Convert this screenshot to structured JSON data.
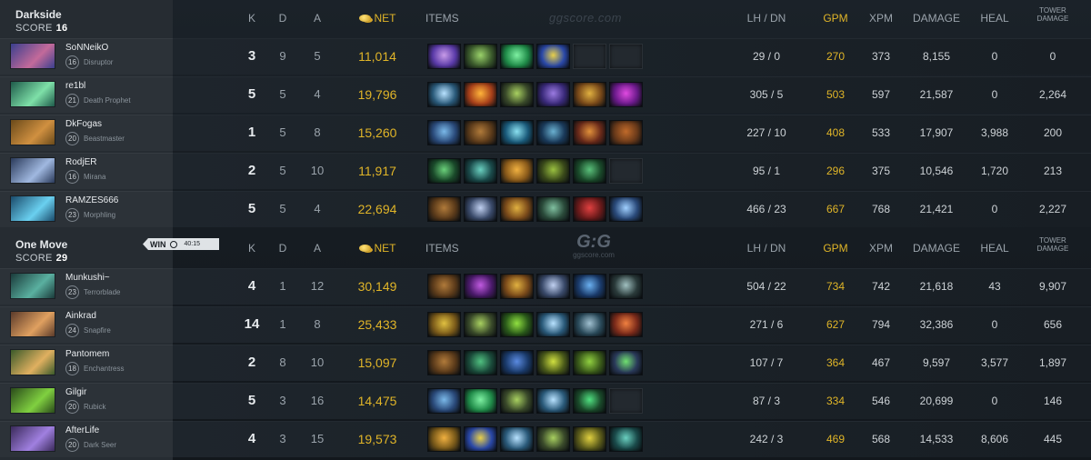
{
  "header_columns": {
    "k": "K",
    "d": "D",
    "a": "A",
    "net": "NET",
    "items": "ITEMS",
    "lhdn": "LH / DN",
    "gpm": "GPM",
    "xpm": "XPM",
    "damage": "DAMAGE",
    "heal": "HEAL",
    "tower": "TOWER DAMAGE"
  },
  "watermark_text": "ggscore.com",
  "logo": {
    "big": "G:G",
    "small": "ggscore.com"
  },
  "win_badge": {
    "label": "WIN",
    "time": "40:15"
  },
  "score_label": "SCORE",
  "teams": [
    {
      "name": "Darkside",
      "score": "16",
      "players": [
        {
          "player": "SoNNeikO",
          "level": "16",
          "hero": "Disruptor",
          "portrait": [
            "#3a3f8e",
            "#c36a9a"
          ],
          "k": "3",
          "d": "9",
          "a": "5",
          "net": "11,014",
          "items": [
            [
              "#5a3aa8",
              "#c89be8"
            ],
            [
              "#3b5a2c",
              "#9ad26a"
            ],
            [
              "#1f8a48",
              "#7ef0a2"
            ],
            [
              "#2a48a8",
              "#e8d04a"
            ],
            null,
            null
          ],
          "lhdn": "29 / 0",
          "gpm": "270",
          "xpm": "373",
          "damage": "8,155",
          "heal": "0",
          "tower": "0"
        },
        {
          "player": "re1bl",
          "level": "21",
          "hero": "Death Prophet",
          "portrait": [
            "#1e5a4a",
            "#7ee0a8"
          ],
          "k": "5",
          "d": "5",
          "a": "4",
          "net": "19,796",
          "items": [
            [
              "#2a5a7a",
              "#b8e2ff"
            ],
            [
              "#a8401a",
              "#ffb43a"
            ],
            [
              "#3a4a2a",
              "#a8d060"
            ],
            [
              "#3a2a7a",
              "#9a7ae0"
            ],
            [
              "#7a4a1a",
              "#e0b040"
            ],
            [
              "#6a1a8a",
              "#e04ae0"
            ]
          ],
          "lhdn": "305 / 5",
          "gpm": "503",
          "xpm": "597",
          "damage": "21,587",
          "heal": "0",
          "tower": "2,264"
        },
        {
          "player": "DkFogas",
          "level": "20",
          "hero": "Beastmaster",
          "portrait": [
            "#6a4a1a",
            "#d09040"
          ],
          "k": "1",
          "d": "5",
          "a": "8",
          "net": "15,260",
          "items": [
            [
              "#2a4a7a",
              "#7ab8e8"
            ],
            [
              "#5a3a1a",
              "#b07a3a"
            ],
            [
              "#1a5a7a",
              "#8ae0f0"
            ],
            [
              "#1a3a5a",
              "#6ab0d0"
            ],
            [
              "#6a2a1a",
              "#e0903a"
            ],
            [
              "#6a3a1a",
              "#c06a2a"
            ]
          ],
          "lhdn": "227 / 10",
          "gpm": "408",
          "xpm": "533",
          "damage": "17,907",
          "heal": "3,988",
          "tower": "200"
        },
        {
          "player": "RodjER",
          "level": "16",
          "hero": "Mirana",
          "portrait": [
            "#2a3a5a",
            "#a0b8e0"
          ],
          "k": "2",
          "d": "5",
          "a": "10",
          "net": "11,917",
          "items": [
            [
              "#1a4a2a",
              "#6ad07a"
            ],
            [
              "#1a4a4a",
              "#6ad0c0"
            ],
            [
              "#8a5a1a",
              "#f0b040"
            ],
            [
              "#3a4a1a",
              "#9ac040"
            ],
            [
              "#1a4a2a",
              "#5ac07a"
            ],
            null
          ],
          "lhdn": "95 / 1",
          "gpm": "296",
          "xpm": "375",
          "damage": "10,546",
          "heal": "1,720",
          "tower": "213"
        },
        {
          "player": "RAMZES666",
          "level": "23",
          "hero": "Morphling",
          "portrait": [
            "#1a4a6a",
            "#6ad0f0"
          ],
          "k": "5",
          "d": "5",
          "a": "4",
          "net": "22,694",
          "items": [
            [
              "#5a3a1a",
              "#b07a3a"
            ],
            [
              "#3a4a6a",
              "#c0d0f0"
            ],
            [
              "#7a4a1a",
              "#e0b040"
            ],
            [
              "#2a4a3a",
              "#80c0a0"
            ],
            [
              "#6a1a1a",
              "#e04040"
            ],
            [
              "#2a4a7a",
              "#a0d0ff"
            ]
          ],
          "lhdn": "466 / 23",
          "gpm": "667",
          "xpm": "768",
          "damage": "21,421",
          "heal": "0",
          "tower": "2,227"
        }
      ]
    },
    {
      "name": "One Move",
      "score": "29",
      "players": [
        {
          "player": "Munkushi~",
          "level": "23",
          "hero": "Terrorblade",
          "portrait": [
            "#1a3a3a",
            "#5ab0a0"
          ],
          "k": "4",
          "d": "1",
          "a": "12",
          "net": "30,149",
          "items": [
            [
              "#5a3a1a",
              "#b07a3a"
            ],
            [
              "#4a1a6a",
              "#c05ae0"
            ],
            [
              "#7a4a1a",
              "#e0b040"
            ],
            [
              "#3a4a6a",
              "#c0d0f0"
            ],
            [
              "#1a3a6a",
              "#6ab0f0"
            ],
            [
              "#2a3a3a",
              "#a0c0c0"
            ]
          ],
          "lhdn": "504 / 22",
          "gpm": "734",
          "xpm": "742",
          "damage": "21,618",
          "heal": "43",
          "tower": "9,907"
        },
        {
          "player": "Ainkrad",
          "level": "24",
          "hero": "Snapfire",
          "portrait": [
            "#5a3a2a",
            "#e0a060"
          ],
          "k": "14",
          "d": "1",
          "a": "8",
          "net": "25,433",
          "items": [
            [
              "#7a5a1a",
              "#e0c040"
            ],
            [
              "#3a4a2a",
              "#a8d060"
            ],
            [
              "#2a5a1a",
              "#90e040"
            ],
            [
              "#2a5a7a",
              "#b8e2ff"
            ],
            [
              "#2a4a5a",
              "#a0c0d0"
            ],
            [
              "#7a2a1a",
              "#f08040"
            ]
          ],
          "lhdn": "271 / 6",
          "gpm": "627",
          "xpm": "794",
          "damage": "32,386",
          "heal": "0",
          "tower": "656"
        },
        {
          "player": "Pantomem",
          "level": "18",
          "hero": "Enchantress",
          "portrait": [
            "#3a5a2a",
            "#e0b060"
          ],
          "k": "2",
          "d": "8",
          "a": "10",
          "net": "15,097",
          "items": [
            [
              "#5a3a1a",
              "#b07a3a"
            ],
            [
              "#1a4a3a",
              "#50c080"
            ],
            [
              "#1a3a6a",
              "#5a8ae0"
            ],
            [
              "#4a5a1a",
              "#d0e040"
            ],
            [
              "#3a5a1a",
              "#90d040"
            ],
            [
              "#2a3a5a",
              "#70e070"
            ]
          ],
          "lhdn": "107 / 7",
          "gpm": "364",
          "xpm": "467",
          "damage": "9,597",
          "heal": "3,577",
          "tower": "1,897"
        },
        {
          "player": "Gilgir",
          "level": "20",
          "hero": "Rubick",
          "portrait": [
            "#2a4a1a",
            "#80d040"
          ],
          "k": "5",
          "d": "3",
          "a": "16",
          "net": "14,475",
          "items": [
            [
              "#2a4a7a",
              "#7ab8e8"
            ],
            [
              "#1f8a48",
              "#7ef0a2"
            ],
            [
              "#3a4a2a",
              "#a8d060"
            ],
            [
              "#2a5a7a",
              "#b8e2ff"
            ],
            [
              "#1a4a2a",
              "#50e080"
            ],
            null
          ],
          "lhdn": "87 / 3",
          "gpm": "334",
          "xpm": "546",
          "damage": "20,699",
          "heal": "0",
          "tower": "146"
        },
        {
          "player": "AfterLife",
          "level": "20",
          "hero": "Dark Seer",
          "portrait": [
            "#3a2a5a",
            "#a080e0"
          ],
          "k": "4",
          "d": "3",
          "a": "15",
          "net": "19,573",
          "items": [
            [
              "#7a5a1a",
              "#f0b040"
            ],
            [
              "#2a48a8",
              "#e8d04a"
            ],
            [
              "#2a5a7a",
              "#b8e2ff"
            ],
            [
              "#3a4a2a",
              "#a8d060"
            ],
            [
              "#5a5a1a",
              "#e0d040"
            ],
            [
              "#1a4a4a",
              "#6ad0c0"
            ]
          ],
          "lhdn": "242 / 3",
          "gpm": "469",
          "xpm": "568",
          "damage": "14,533",
          "heal": "8,606",
          "tower": "445"
        }
      ]
    }
  ]
}
